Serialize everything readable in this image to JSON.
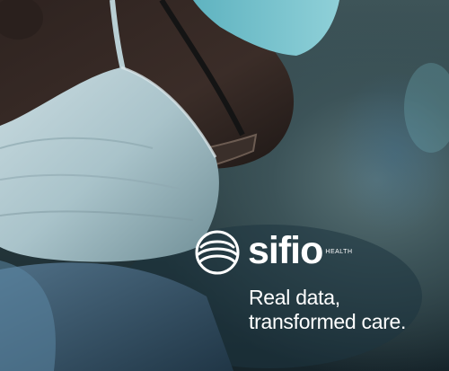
{
  "ad": {
    "brand_name": "sifio",
    "brand_sub": "HEALTH",
    "tagline_line1": "Real data,",
    "tagline_line2": "transformed care."
  }
}
